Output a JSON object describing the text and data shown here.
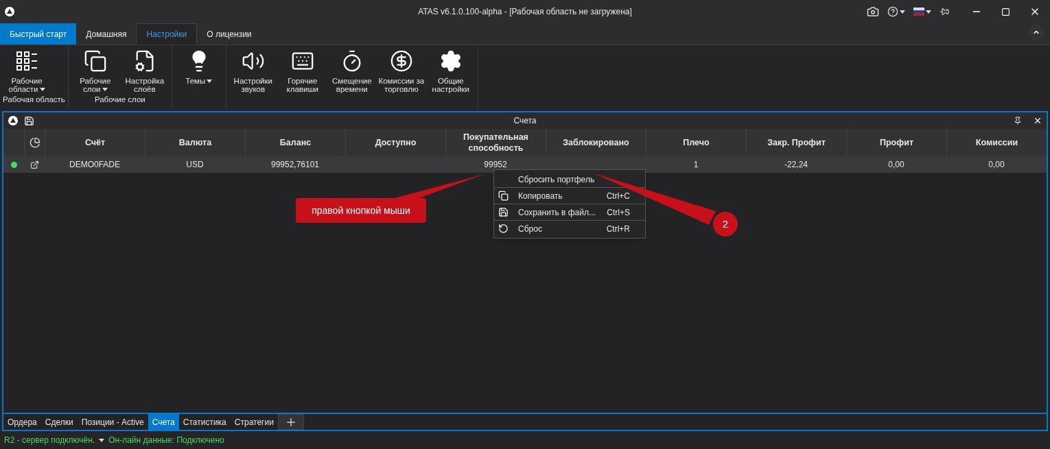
{
  "window": {
    "title": "ATAS v6.1.0.100-alpha - [Рабочая область не загружена]"
  },
  "tabs": [
    {
      "label": "Быстрый старт",
      "kind": "quick"
    },
    {
      "label": "Домашняя",
      "selected": false
    },
    {
      "label": "Настройки",
      "selected": true
    },
    {
      "label": "О лицензии",
      "selected": false
    }
  ],
  "ribbon": [
    {
      "label": "Рабочая область",
      "buttons": [
        {
          "label": "Рабочие области",
          "dropdown": true
        }
      ]
    },
    {
      "label": "Рабочие слои",
      "buttons": [
        {
          "label": "Рабочие слои",
          "dropdown": true
        },
        {
          "label": "Настройка слоёв",
          "dropdown": false
        }
      ]
    },
    {
      "buttons": [
        {
          "label": "Темы",
          "dropdown": true
        }
      ]
    },
    {
      "buttons": [
        {
          "label": "Настройки звуков",
          "dropdown": false
        },
        {
          "label": "Горячие клавиши",
          "dropdown": false
        },
        {
          "label": "Смещение времени",
          "dropdown": false
        },
        {
          "label": "Комиссии за торговлю",
          "dropdown": false
        },
        {
          "label": "Общие настройки",
          "dropdown": false
        }
      ]
    }
  ],
  "panel": {
    "title": "Счета",
    "columns": [
      "Счёт",
      "Валюта",
      "Баланс",
      "Доступно",
      "Покупательная способность",
      "Заблокировано",
      "Плечо",
      "Закр. Профит",
      "Профит",
      "Комиссии"
    ],
    "rows": [
      {
        "color": "#4cd964",
        "cells": [
          "DEMO0FADE",
          "USD",
          "99952,76101",
          null,
          "99952",
          null,
          "1",
          "-22,24",
          "0,00",
          "0,00"
        ]
      }
    ]
  },
  "context_menu": [
    {
      "label": "Сбросить портфель"
    },
    {
      "label": "Копировать",
      "shortcut": "Ctrl+C"
    },
    {
      "label": "Сохранить в файл...",
      "shortcut": "Ctrl+S"
    },
    {
      "label": "Сброс",
      "shortcut": "Ctrl+R"
    }
  ],
  "annotations": [
    {
      "kind": "callout",
      "text": "правой кнопкой мыши"
    },
    {
      "kind": "badge",
      "text": "2"
    }
  ],
  "bottom_tabs": [
    {
      "label": "Ордера",
      "selected": false
    },
    {
      "label": "Сделки",
      "selected": false
    },
    {
      "label": "Позиции - Active",
      "selected": false
    },
    {
      "label": "Счета",
      "selected": true
    },
    {
      "label": "Статистика",
      "selected": false
    },
    {
      "label": "Стратегии",
      "selected": false
    }
  ],
  "status": {
    "connection": "R2 - сервер подключён.",
    "data": "Он-лайн данные: Подключено"
  }
}
